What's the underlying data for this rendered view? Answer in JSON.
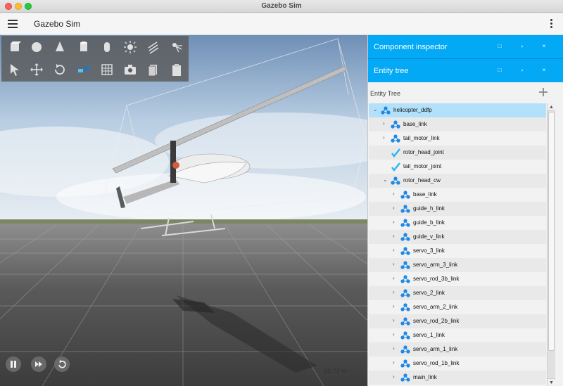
{
  "window": {
    "title": "Gazebo Sim"
  },
  "appbar": {
    "title": "Gazebo Sim",
    "menu_icon": "hamburger-icon",
    "more_icon": "more-vertical-icon"
  },
  "toolbar": {
    "row1": [
      "box-icon",
      "sphere-icon",
      "cone-icon",
      "cylinder-icon",
      "capsule-icon",
      "sun-light-icon",
      "directional-light-icon",
      "spot-light-icon"
    ],
    "row2": [
      "select-arrow-icon",
      "translate-icon",
      "rotate-icon",
      "snap-icon",
      "grid-config-icon",
      "screenshot-camera-icon",
      "copy-icon",
      "paste-icon"
    ]
  },
  "playback": {
    "buttons": [
      "pause-icon",
      "step-icon",
      "reset-icon"
    ],
    "rtf": "92.72 %"
  },
  "panels": [
    {
      "title": "Component inspector",
      "buttons": [
        "restore-icon",
        "chevron-icon",
        "close-icon"
      ]
    },
    {
      "title": "Entity tree",
      "buttons": [
        "restore-icon",
        "chevron-icon",
        "close-icon"
      ]
    }
  ],
  "tree": {
    "label": "Entity Tree",
    "add_icon": "plus-icon",
    "rows": [
      {
        "label": "helicopter_ddfp",
        "depth": 0,
        "arrow": "down",
        "icon": "model-icon",
        "selected": true
      },
      {
        "label": "base_link",
        "depth": 1,
        "arrow": "right",
        "icon": "link-icon"
      },
      {
        "label": "tail_motor_link",
        "depth": 1,
        "arrow": "right",
        "icon": "link-icon"
      },
      {
        "label": "rotor_head_joint",
        "depth": 1,
        "arrow": "",
        "icon": "joint-icon"
      },
      {
        "label": "tail_motor_joint",
        "depth": 1,
        "arrow": "",
        "icon": "joint-icon"
      },
      {
        "label": "rotor_head_cw",
        "depth": 1,
        "arrow": "down",
        "icon": "model-icon"
      },
      {
        "label": "base_link",
        "depth": 2,
        "arrow": "right",
        "icon": "link-icon"
      },
      {
        "label": "guide_h_link",
        "depth": 2,
        "arrow": "right",
        "icon": "link-icon"
      },
      {
        "label": "guide_b_link",
        "depth": 2,
        "arrow": "right",
        "icon": "link-icon"
      },
      {
        "label": "guide_v_link",
        "depth": 2,
        "arrow": "right",
        "icon": "link-icon"
      },
      {
        "label": "servo_3_link",
        "depth": 2,
        "arrow": "right",
        "icon": "link-icon"
      },
      {
        "label": "servo_arm_3_link",
        "depth": 2,
        "arrow": "right",
        "icon": "link-icon"
      },
      {
        "label": "servo_rod_3b_link",
        "depth": 2,
        "arrow": "right",
        "icon": "link-icon"
      },
      {
        "label": "servo_2_link",
        "depth": 2,
        "arrow": "right",
        "icon": "link-icon"
      },
      {
        "label": "servo_arm_2_link",
        "depth": 2,
        "arrow": "right",
        "icon": "link-icon"
      },
      {
        "label": "servo_rod_2b_link",
        "depth": 2,
        "arrow": "right",
        "icon": "link-icon"
      },
      {
        "label": "servo_1_link",
        "depth": 2,
        "arrow": "right",
        "icon": "link-icon"
      },
      {
        "label": "servo_arm_1_link",
        "depth": 2,
        "arrow": "right",
        "icon": "link-icon"
      },
      {
        "label": "servo_rod_1b_link",
        "depth": 2,
        "arrow": "right",
        "icon": "link-icon"
      },
      {
        "label": "main_link",
        "depth": 2,
        "arrow": "right",
        "icon": "link-icon"
      },
      {
        "label": "",
        "depth": 2,
        "arrow": "right",
        "icon": "link-icon"
      }
    ]
  },
  "colors": {
    "accent": "#03a9f4",
    "selected_row": "#b3e1fb",
    "toolbar_bg": "#5a5a5a"
  }
}
